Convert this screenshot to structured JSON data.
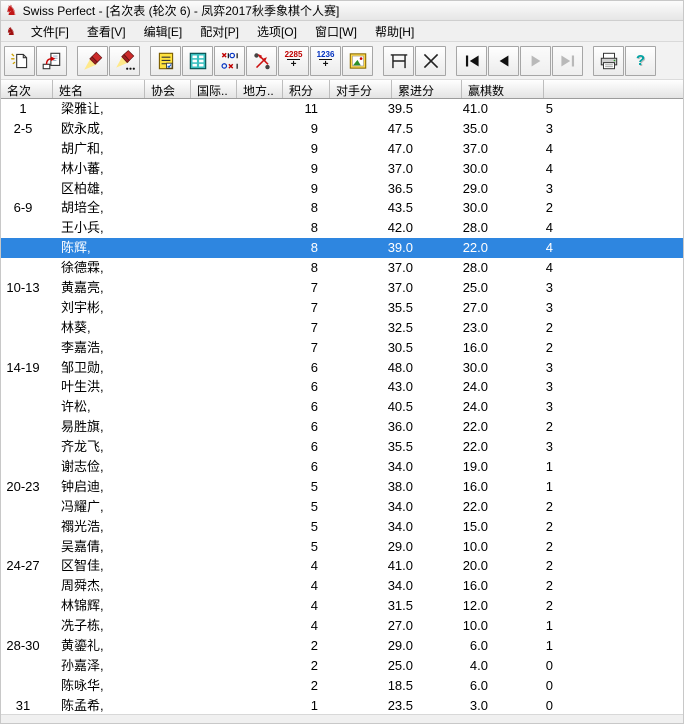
{
  "window": {
    "title": "Swiss Perfect - [名次表  (轮次 6) - 凤弈2017秋季象棋个人赛]"
  },
  "icons": {
    "app_logo_glyph": "♞",
    "child_window_glyph": "♞",
    "help_glyph": "?",
    "plus_glyph": "+"
  },
  "menu_bar": {
    "items": [
      {
        "name": "file",
        "label": "文件[F]"
      },
      {
        "name": "view",
        "label": "查看[V]"
      },
      {
        "name": "edit",
        "label": "编辑[E]"
      },
      {
        "name": "pairing",
        "label": "配对[P]"
      },
      {
        "name": "options",
        "label": "选项[O]"
      },
      {
        "name": "window",
        "label": "窗口[W]"
      },
      {
        "name": "help",
        "label": "帮助[H]"
      }
    ]
  },
  "toolbar": {
    "buttons": [
      {
        "name": "new-tournament",
        "icon": "new-document-icon",
        "enabled": true
      },
      {
        "name": "open-report",
        "icon": "document-arrow-icon",
        "enabled": true
      },
      {
        "name": "search",
        "icon": "flashlight-icon",
        "enabled": true
      },
      {
        "name": "search-more",
        "icon": "flashlight-ellipsis-icon",
        "enabled": true
      },
      {
        "name": "pairings-list",
        "icon": "yellow-list-icon",
        "enabled": true
      },
      {
        "name": "standings-list",
        "icon": "teal-list-icon",
        "enabled": true
      },
      {
        "name": "cross-table",
        "icon": "cross-table-icon",
        "enabled": true
      },
      {
        "name": "do-pairing",
        "icon": "pairing-arrows-icon",
        "enabled": true
      },
      {
        "name": "international-rating",
        "icon": "rating-2285-icon",
        "label": "2285",
        "enabled": true
      },
      {
        "name": "local-rating",
        "icon": "rating-1236-icon",
        "label": "1236",
        "enabled": true
      },
      {
        "name": "wall-chart",
        "icon": "picture-icon",
        "enabled": true
      },
      {
        "name": "round-table",
        "icon": "bracket-table-icon",
        "enabled": true
      },
      {
        "name": "cut-round",
        "icon": "scissors-icon",
        "enabled": true
      },
      {
        "name": "first-round",
        "icon": "first-icon",
        "enabled": true
      },
      {
        "name": "previous-round",
        "icon": "previous-icon",
        "enabled": true
      },
      {
        "name": "next-round",
        "icon": "next-icon",
        "enabled": false
      },
      {
        "name": "last-round",
        "icon": "last-icon",
        "enabled": false
      },
      {
        "name": "print",
        "icon": "printer-icon",
        "enabled": true
      },
      {
        "name": "help",
        "icon": "help-icon",
        "label": "?",
        "enabled": true
      }
    ]
  },
  "standings_table": {
    "columns": [
      "名次",
      "姓名",
      "协会",
      "国际..",
      "地方..",
      "积分",
      "对手分",
      "累进分",
      "赢棋数"
    ],
    "selected_row_index": 7,
    "rows": [
      {
        "rank": "1",
        "name": "梁雅让,",
        "points": "11",
        "opp_score": "39.5",
        "progressive": "41.0",
        "wins": "5"
      },
      {
        "rank": "2-5",
        "name": "欧永成,",
        "points": "9",
        "opp_score": "47.5",
        "progressive": "35.0",
        "wins": "3"
      },
      {
        "rank": "",
        "name": "胡广和,",
        "points": "9",
        "opp_score": "47.0",
        "progressive": "37.0",
        "wins": "4"
      },
      {
        "rank": "",
        "name": "林小蕃,",
        "points": "9",
        "opp_score": "37.0",
        "progressive": "30.0",
        "wins": "4"
      },
      {
        "rank": "",
        "name": "区柏雄,",
        "points": "9",
        "opp_score": "36.5",
        "progressive": "29.0",
        "wins": "3"
      },
      {
        "rank": "6-9",
        "name": "胡培全,",
        "points": "8",
        "opp_score": "43.5",
        "progressive": "30.0",
        "wins": "2"
      },
      {
        "rank": "",
        "name": "王小兵,",
        "points": "8",
        "opp_score": "42.0",
        "progressive": "28.0",
        "wins": "4"
      },
      {
        "rank": "",
        "name": "陈辉,",
        "points": "8",
        "opp_score": "39.0",
        "progressive": "22.0",
        "wins": "4"
      },
      {
        "rank": "",
        "name": "徐德霖,",
        "points": "8",
        "opp_score": "37.0",
        "progressive": "28.0",
        "wins": "4"
      },
      {
        "rank": "10-13",
        "name": "黄嘉亮,",
        "points": "7",
        "opp_score": "37.0",
        "progressive": "25.0",
        "wins": "3"
      },
      {
        "rank": "",
        "name": "刘宇彬,",
        "points": "7",
        "opp_score": "35.5",
        "progressive": "27.0",
        "wins": "3"
      },
      {
        "rank": "",
        "name": "林葵,",
        "points": "7",
        "opp_score": "32.5",
        "progressive": "23.0",
        "wins": "2"
      },
      {
        "rank": "",
        "name": "李嘉浩,",
        "points": "7",
        "opp_score": "30.5",
        "progressive": "16.0",
        "wins": "2"
      },
      {
        "rank": "14-19",
        "name": "邹卫勋,",
        "points": "6",
        "opp_score": "48.0",
        "progressive": "30.0",
        "wins": "3"
      },
      {
        "rank": "",
        "name": "叶生洪,",
        "points": "6",
        "opp_score": "43.0",
        "progressive": "24.0",
        "wins": "3"
      },
      {
        "rank": "",
        "name": "许松,",
        "points": "6",
        "opp_score": "40.5",
        "progressive": "24.0",
        "wins": "3"
      },
      {
        "rank": "",
        "name": "易胜旗,",
        "points": "6",
        "opp_score": "36.0",
        "progressive": "22.0",
        "wins": "2"
      },
      {
        "rank": "",
        "name": "齐龙飞,",
        "points": "6",
        "opp_score": "35.5",
        "progressive": "22.0",
        "wins": "3"
      },
      {
        "rank": "",
        "name": "谢志俭,",
        "points": "6",
        "opp_score": "34.0",
        "progressive": "19.0",
        "wins": "1"
      },
      {
        "rank": "20-23",
        "name": "钟启迪,",
        "points": "5",
        "opp_score": "38.0",
        "progressive": "16.0",
        "wins": "1"
      },
      {
        "rank": "",
        "name": "冯耀广,",
        "points": "5",
        "opp_score": "34.0",
        "progressive": "22.0",
        "wins": "2"
      },
      {
        "rank": "",
        "name": "禤光浩,",
        "points": "5",
        "opp_score": "34.0",
        "progressive": "15.0",
        "wins": "2"
      },
      {
        "rank": "",
        "name": "吴嘉倩,",
        "points": "5",
        "opp_score": "29.0",
        "progressive": "10.0",
        "wins": "2"
      },
      {
        "rank": "24-27",
        "name": "区智佳,",
        "points": "4",
        "opp_score": "41.0",
        "progressive": "20.0",
        "wins": "2"
      },
      {
        "rank": "",
        "name": "周舜杰,",
        "points": "4",
        "opp_score": "34.0",
        "progressive": "16.0",
        "wins": "2"
      },
      {
        "rank": "",
        "name": "林锦辉,",
        "points": "4",
        "opp_score": "31.5",
        "progressive": "12.0",
        "wins": "2"
      },
      {
        "rank": "",
        "name": "冼子栋,",
        "points": "4",
        "opp_score": "27.0",
        "progressive": "10.0",
        "wins": "1"
      },
      {
        "rank": "28-30",
        "name": "黄鎏礼,",
        "points": "2",
        "opp_score": "29.0",
        "progressive": "6.0",
        "wins": "1"
      },
      {
        "rank": "",
        "name": "孙嘉泽,",
        "points": "2",
        "opp_score": "25.0",
        "progressive": "4.0",
        "wins": "0"
      },
      {
        "rank": "",
        "name": "陈咏华,",
        "points": "2",
        "opp_score": "18.5",
        "progressive": "6.0",
        "wins": "0"
      },
      {
        "rank": "31",
        "name": "陈孟希,",
        "points": "1",
        "opp_score": "23.5",
        "progressive": "3.0",
        "wins": "0"
      }
    ]
  },
  "colors": {
    "selection_bg": "#2e86e0",
    "selection_text": "#ffffff",
    "window_bg": "#f0f0f0"
  }
}
